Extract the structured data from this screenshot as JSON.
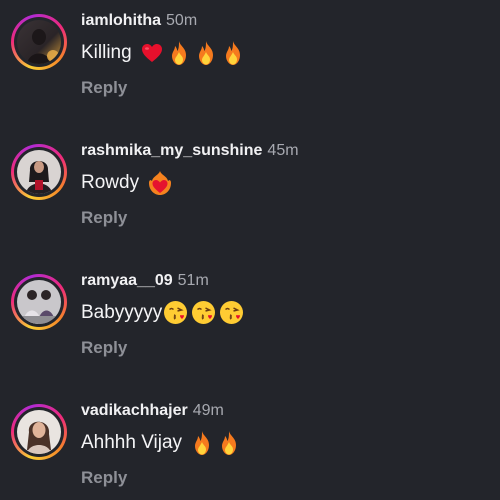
{
  "comments": [
    {
      "username": "iamlohitha",
      "time": "50m",
      "text": "Killing",
      "emojis": [
        "heart-emoji",
        "fire-emoji",
        "fire-emoji",
        "fire-emoji"
      ],
      "reply_label": "Reply"
    },
    {
      "username": "rashmika_my_sunshine",
      "time": "45m",
      "text": "Rowdy",
      "emojis": [
        "heart-on-fire-emoji"
      ],
      "reply_label": "Reply"
    },
    {
      "username": "ramyaa__09",
      "time": "51m",
      "text": "Babyyyyy",
      "emojis": [
        "kissing-face-emoji",
        "kissing-face-emoji",
        "kissing-face-emoji"
      ],
      "reply_label": "Reply"
    },
    {
      "username": "vadikachhajer",
      "time": "49m",
      "text": "Ahhhh Vijay",
      "emojis": [
        "fire-emoji",
        "fire-emoji"
      ],
      "reply_label": "Reply"
    }
  ],
  "colors": {
    "background": "#23252b",
    "username": "#f1f1f3",
    "time": "#a7a9b0",
    "reply": "#8e9097"
  }
}
